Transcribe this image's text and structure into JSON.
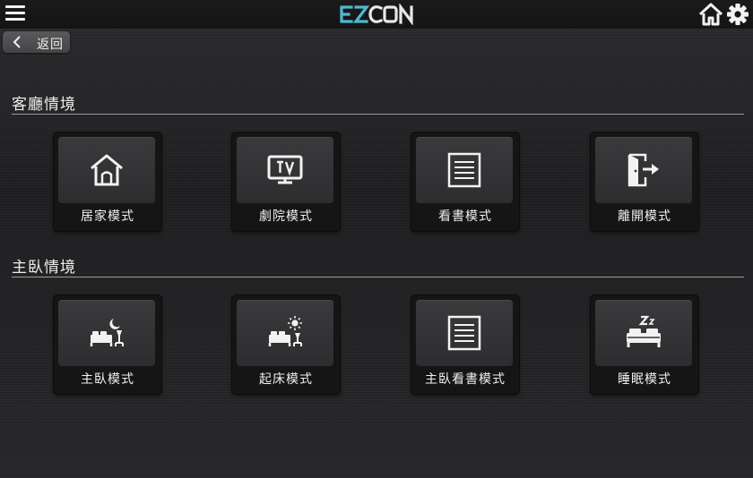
{
  "header": {
    "logo_text": "EZCON",
    "menu_icon": "hamburger-menu-icon",
    "home_icon": "home-icon",
    "settings_icon": "gear-icon"
  },
  "back_button": {
    "label": "返回",
    "icon": "chevron-left-icon"
  },
  "sections": [
    {
      "title": "客廳情境",
      "scenes": [
        {
          "label": "居家模式",
          "icon": "house-icon"
        },
        {
          "label": "劇院模式",
          "icon": "tv-icon"
        },
        {
          "label": "看書模式",
          "icon": "document-lines-icon"
        },
        {
          "label": "離開模式",
          "icon": "exit-door-icon"
        }
      ]
    },
    {
      "title": "主臥情境",
      "scenes": [
        {
          "label": "主臥模式",
          "icon": "bed-moon-icon"
        },
        {
          "label": "起床模式",
          "icon": "bed-sun-icon"
        },
        {
          "label": "主臥看書模式",
          "icon": "document-lines-icon"
        },
        {
          "label": "睡眠模式",
          "icon": "bed-sleep-icon"
        }
      ]
    }
  ],
  "colors": {
    "accent_logo": "#4fb8cf",
    "background": "#262628",
    "tile_face": "#353537"
  }
}
